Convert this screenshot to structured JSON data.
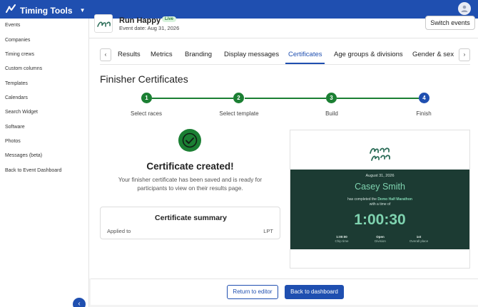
{
  "app": {
    "name": "Timing Tools"
  },
  "sidebar": {
    "items": [
      {
        "label": "Events"
      },
      {
        "label": "Companies"
      },
      {
        "label": "Timing crews"
      },
      {
        "label": "Custom columns"
      },
      {
        "label": "Templates"
      },
      {
        "label": "Calendars"
      },
      {
        "label": "Search Widget"
      },
      {
        "label": "Software"
      },
      {
        "label": "Photos"
      },
      {
        "label": "Messages (beta)"
      },
      {
        "label": "Back to Event Dashboard"
      }
    ]
  },
  "event": {
    "name": "Run Happy",
    "status": "Live",
    "date": "Event date: Aug 31, 2026",
    "switch_label": "Switch events"
  },
  "tabs": [
    {
      "label": "Results"
    },
    {
      "label": "Metrics"
    },
    {
      "label": "Branding"
    },
    {
      "label": "Display messages"
    },
    {
      "label": "Certificates",
      "active": true
    },
    {
      "label": "Age groups & divisions"
    },
    {
      "label": "Gender & sex"
    }
  ],
  "page": {
    "title": "Finisher Certificates"
  },
  "steps": [
    {
      "number": "1",
      "label": "Select races",
      "state": "done"
    },
    {
      "number": "2",
      "label": "Select template",
      "state": "done"
    },
    {
      "number": "3",
      "label": "Build",
      "state": "done"
    },
    {
      "number": "4",
      "label": "Finish",
      "state": "current"
    }
  ],
  "success": {
    "title": "Certificate created!",
    "message": "Your finisher certificate has been saved and is ready for participants to view on their results page."
  },
  "summary": {
    "title": "Certificate summary",
    "applied_label": "Applied to",
    "applied_value": "LPT"
  },
  "certificate": {
    "logo_text": "Run Happy",
    "date": "August 31, 2026",
    "name": "Casey Smith",
    "completed_prefix": "has completed the",
    "race": "Demo Half Marathon",
    "time_prefix": "with a time of",
    "time": "1:00:30",
    "stats": [
      {
        "value": "1:00:00",
        "label": "Chip time"
      },
      {
        "value": "Open",
        "label": "Division"
      },
      {
        "value": "1st",
        "label": "Overall place"
      }
    ]
  },
  "footer": {
    "return_label": "Return to editor",
    "dashboard_label": "Back to dashboard"
  },
  "colors": {
    "brand_blue": "#1f4fb0",
    "success_green": "#1b7f33",
    "certificate_bg": "#1c3b33",
    "certificate_accent": "#7fd3b0"
  }
}
